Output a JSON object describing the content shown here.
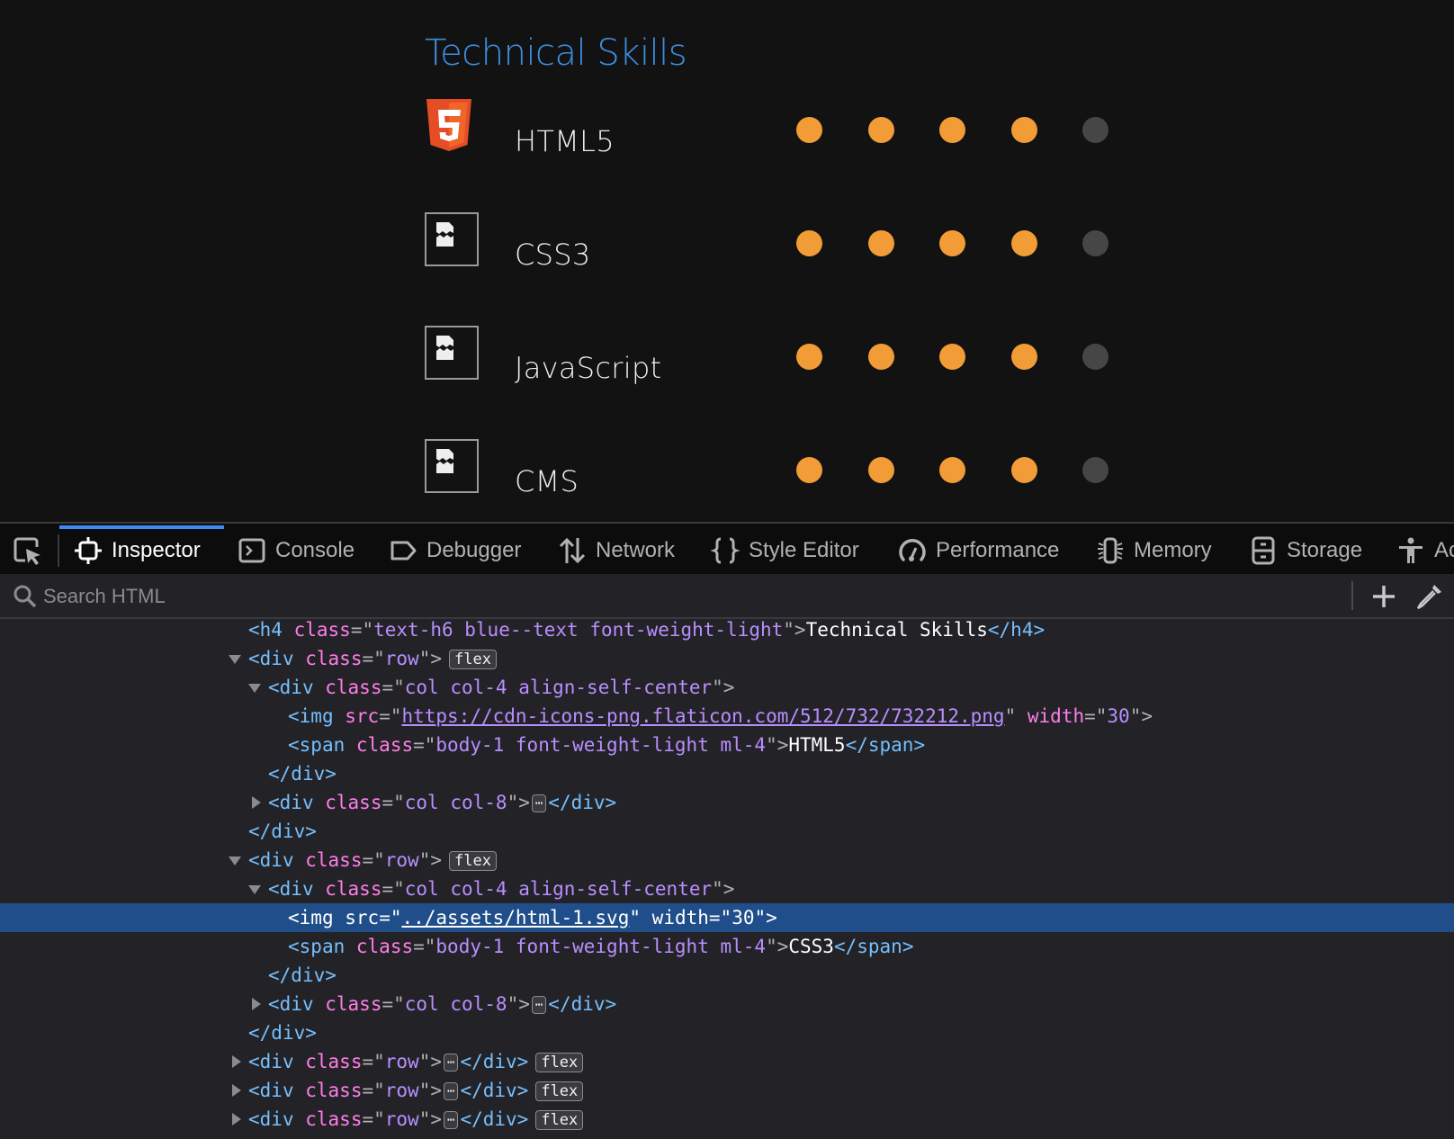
{
  "page": {
    "section_title": "Technical Skills",
    "skills": [
      {
        "name": "HTML5",
        "icon": "html5-logo-icon",
        "icon_broken": false,
        "rating": 4,
        "max": 5
      },
      {
        "name": "CSS3",
        "icon": "broken-image-icon",
        "icon_broken": true,
        "rating": 4,
        "max": 5
      },
      {
        "name": "JavaScript",
        "icon": "broken-image-icon",
        "icon_broken": true,
        "rating": 4,
        "max": 5
      },
      {
        "name": "CMS",
        "icon": "broken-image-icon",
        "icon_broken": true,
        "rating": 4,
        "max": 5
      }
    ],
    "colors": {
      "title": "#3d8fe0",
      "dot_on": "#f29c38",
      "dot_off": "#464646"
    }
  },
  "devtools": {
    "tabs": [
      {
        "label": "Inspector",
        "icon": "inspector-icon",
        "active": true
      },
      {
        "label": "Console",
        "icon": "console-icon",
        "active": false
      },
      {
        "label": "Debugger",
        "icon": "debugger-icon",
        "active": false
      },
      {
        "label": "Network",
        "icon": "network-icon",
        "active": false
      },
      {
        "label": "Style Editor",
        "icon": "style-editor-icon",
        "active": false
      },
      {
        "label": "Performance",
        "icon": "performance-icon",
        "active": false
      },
      {
        "label": "Memory",
        "icon": "memory-icon",
        "active": false
      },
      {
        "label": "Storage",
        "icon": "storage-icon",
        "active": false
      },
      {
        "label": "Ac",
        "icon": "accessibility-icon",
        "active": false
      }
    ],
    "search": {
      "placeholder": "Search HTML",
      "value": ""
    },
    "badges": {
      "flex": "flex",
      "ellipsis": "⋯"
    },
    "tree": {
      "l0": {
        "tag": "h4",
        "attr": "class",
        "val": "text-h6 blue--text font-weight-light",
        "text": "Technical Skills"
      },
      "l1": {
        "tag": "div",
        "attr": "class",
        "val": "row"
      },
      "l2": {
        "tag": "div",
        "attr": "class",
        "val": "col col-4 align-self-center"
      },
      "l3": {
        "tag": "img",
        "attr": "src",
        "val": "https://cdn-icons-png.flaticon.com/512/732/732212.png",
        "attr2": "width",
        "val2": "30"
      },
      "l4": {
        "tag": "span",
        "attr": "class",
        "val": "body-1 font-weight-light ml-4",
        "text": "HTML5"
      },
      "l5": {
        "tag": "div"
      },
      "l6": {
        "tag": "div",
        "attr": "class",
        "val": "col col-8"
      },
      "l7": {
        "tag": "div"
      },
      "l8": {
        "tag": "div",
        "attr": "class",
        "val": "row"
      },
      "l9": {
        "tag": "div",
        "attr": "class",
        "val": "col col-4 align-self-center"
      },
      "l10": {
        "tag": "img",
        "attr": "src",
        "val": "../assets/html-1.svg",
        "attr2": "width",
        "val2": "30"
      },
      "l11": {
        "tag": "span",
        "attr": "class",
        "val": "body-1 font-weight-light ml-4",
        "text": "CSS3"
      },
      "l12": {
        "tag": "div"
      },
      "l13": {
        "tag": "div",
        "attr": "class",
        "val": "col col-8"
      },
      "l14": {
        "tag": "div"
      },
      "l15": {
        "tag": "div",
        "attr": "class",
        "val": "row"
      },
      "l16": {
        "tag": "div",
        "attr": "class",
        "val": "row"
      },
      "l17": {
        "tag": "div",
        "attr": "class",
        "val": "row"
      }
    }
  }
}
